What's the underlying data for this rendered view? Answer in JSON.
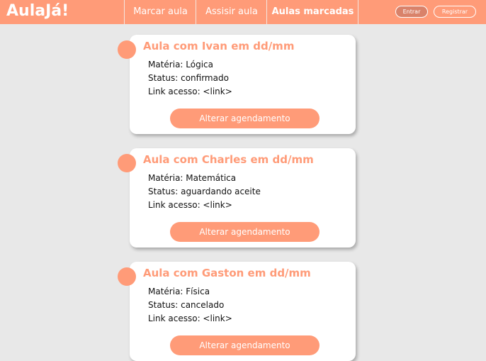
{
  "header": {
    "logo": "AulaJá!",
    "nav": [
      {
        "label": "Marcar aula"
      },
      {
        "label": "Assisir aula"
      },
      {
        "label": "Aulas marcadas"
      }
    ],
    "login_label": "Entrar",
    "register_label": "Registrar"
  },
  "classes": [
    {
      "title": "Aula com Ivan em dd/mm",
      "subject": "Matéria: Lógica",
      "status": "Status: confirmado",
      "link": "Link acesso: <link>",
      "action": "Alterar agendamento"
    },
    {
      "title": "Aula com Charles em dd/mm",
      "subject": "Matéria: Matemática",
      "status": "Status: aguardando aceite",
      "link": "Link acesso: <link>",
      "action": "Alterar agendamento"
    },
    {
      "title": "Aula com Gaston em dd/mm",
      "subject": "Matéria: Física",
      "status": "Status: cancelado",
      "link": "Link acesso: <link>",
      "action": "Alterar agendamento"
    }
  ],
  "colors": {
    "accent": "#ff9b78",
    "background": "#e8e8e8"
  }
}
